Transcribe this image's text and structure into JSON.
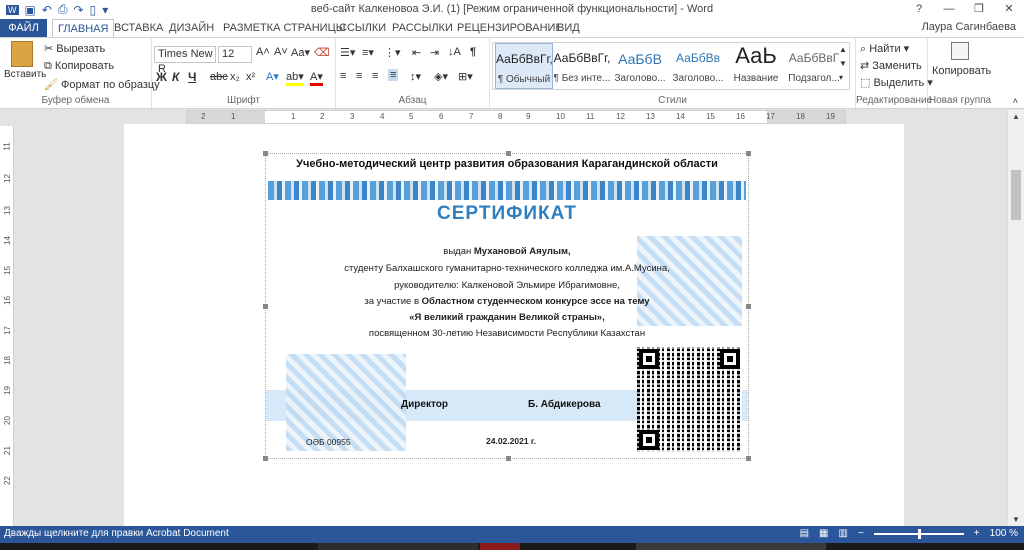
{
  "window": {
    "title": "веб-сайт Калкеновоа Э.И. (1) [Режим ограниченной функциональности] - Word",
    "user": "Лаура Сагинбаева",
    "controls": [
      "?",
      "—",
      "❐",
      "✕"
    ]
  },
  "tabs": {
    "file": "ФАЙЛ",
    "items": [
      "ГЛАВНАЯ",
      "ВСТАВКА",
      "ДИЗАЙН",
      "РАЗМЕТКА СТРАНИЦЫ",
      "ССЫЛКИ",
      "РАССЫЛКИ",
      "РЕЦЕНЗИРОВАНИЕ",
      "ВИД"
    ]
  },
  "ribbon": {
    "clipboard": {
      "paste": "Вставить",
      "cut": "Вырезать",
      "copy": "Копировать",
      "format_painter": "Формат по образцу",
      "label": "Буфер обмена"
    },
    "font": {
      "font_name": "Times New R",
      "font_size": "12",
      "bold": "Ж",
      "italic": "К",
      "underline": "Ч",
      "strike": "abc",
      "subscript": "x₂",
      "superscript": "x²",
      "label": "Шрифт"
    },
    "paragraph": {
      "label": "Абзац"
    },
    "styles": {
      "items": [
        {
          "sample": "АаБбВвГг,",
          "name": "¶ Обычный"
        },
        {
          "sample": "АаБбВвГг,",
          "name": "¶ Без инте..."
        },
        {
          "sample": "АаБбВ",
          "name": "Заголово..."
        },
        {
          "sample": "АаБбВв",
          "name": "Заголово..."
        },
        {
          "sample": "АаЬ",
          "name": "Название"
        },
        {
          "sample": "АаБбВвГ",
          "name": "Подзагол..."
        }
      ],
      "label": "Стили"
    },
    "editing": {
      "find": "Найти",
      "replace": "Заменить",
      "select": "Выделить",
      "label": "Редактирование"
    },
    "new_group": {
      "copy": "Копировать",
      "label": "Новая группа"
    }
  },
  "ruler": {
    "h_ticks": [
      "2",
      "1",
      "1",
      "2",
      "3",
      "4",
      "5",
      "6",
      "7",
      "8",
      "9",
      "10",
      "11",
      "12",
      "13",
      "14",
      "15",
      "16",
      "17",
      "18",
      "19"
    ],
    "v_ticks": [
      "11",
      "12",
      "13",
      "14",
      "15",
      "16",
      "17",
      "18",
      "19",
      "20",
      "21",
      "22"
    ]
  },
  "certificate": {
    "org": "Учебно-методический центр развития образования Карагандинской области",
    "title": "СЕРТИФИКАТ",
    "issued_prefix": "выдан",
    "recipient": "Мухановой Аяулым,",
    "line2": "студенту Балхашского гуманитарно-технического колледжа им.А.Мусина,",
    "line3": "руководителю: Калкеновой Эльмире Ибрагимовне,",
    "line4_prefix": "за участие в",
    "line4_bold": "Областном студенческом конкурсе эссе на тему",
    "line5": "«Я великий гражданин Великой страны»,",
    "line6": "посвященном 30-летию Независимости Республики Казахстан",
    "director_label": "Директор",
    "director_name": "Б. Абдикерова",
    "reg_number": "ОӘБ 00955",
    "date": "24.02.2021 г."
  },
  "statusbar": {
    "hint": "Дважды щелкните для правки Acrobat Document",
    "zoom": "100 %"
  },
  "colors": {
    "word_blue": "#2b579a",
    "cert_title": "#2f7fc1",
    "ornament": "#bcd9f1"
  }
}
